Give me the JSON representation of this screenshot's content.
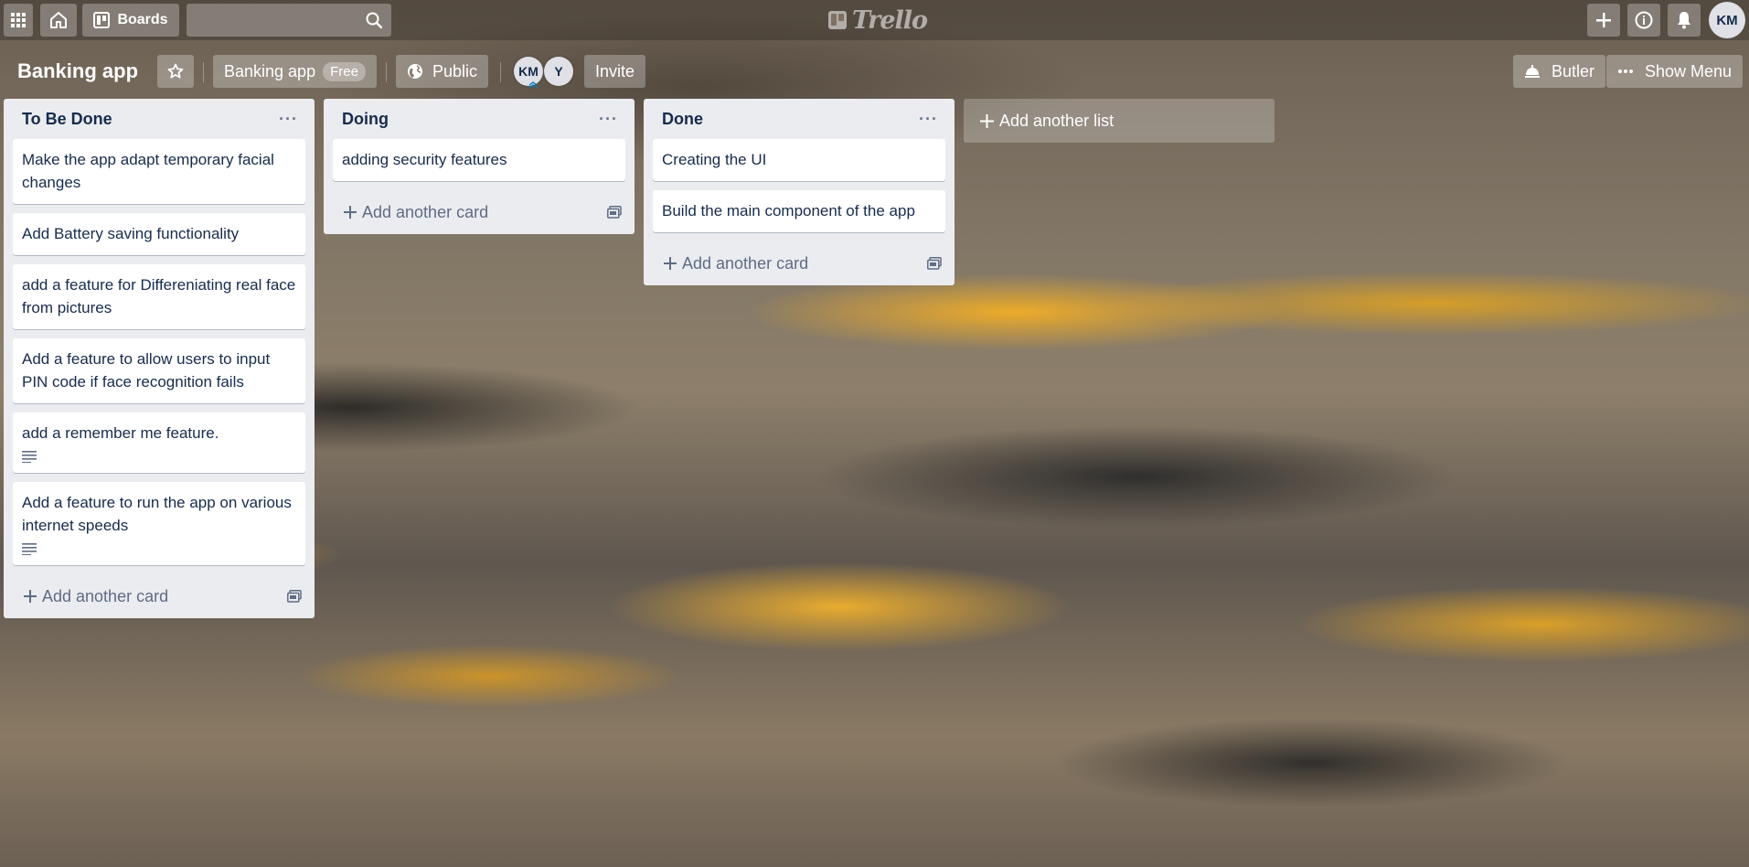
{
  "header": {
    "boards_label": "Boards",
    "search_placeholder": "",
    "logo_text": "Trello",
    "avatar_initials": "KM"
  },
  "board": {
    "title": "Banking app",
    "team_label": "Banking app",
    "plan_badge": "Free",
    "visibility_label": "Public",
    "members": [
      "KM",
      "Y"
    ],
    "invite_label": "Invite",
    "butler_label": "Butler",
    "show_menu_label": "Show Menu"
  },
  "lists": [
    {
      "title": "To Be Done",
      "cards": [
        {
          "title": "Make the app adapt temporary facial changes",
          "has_description": false
        },
        {
          "title": "Add Battery saving functionality",
          "has_description": false
        },
        {
          "title": "add a feature for Differeniating real face from pictures",
          "has_description": false
        },
        {
          "title": "Add a feature to allow users to input PIN code if face recognition fails",
          "has_description": false
        },
        {
          "title": "add a remember me feature.",
          "has_description": true
        },
        {
          "title": "Add a feature to run the app on various internet speeds",
          "has_description": true
        }
      ],
      "add_card_label": "Add another card"
    },
    {
      "title": "Doing",
      "cards": [
        {
          "title": "adding security features",
          "has_description": false
        }
      ],
      "add_card_label": "Add another card"
    },
    {
      "title": "Done",
      "cards": [
        {
          "title": "Creating the UI",
          "has_description": false
        },
        {
          "title": "Build the main component of the app",
          "has_description": false
        }
      ],
      "add_card_label": "Add another card"
    }
  ],
  "add_list_label": "Add another list",
  "colors": {
    "list_bg": "#ebecf0",
    "card_text": "#172b4d",
    "muted_text": "#5e6c84"
  }
}
